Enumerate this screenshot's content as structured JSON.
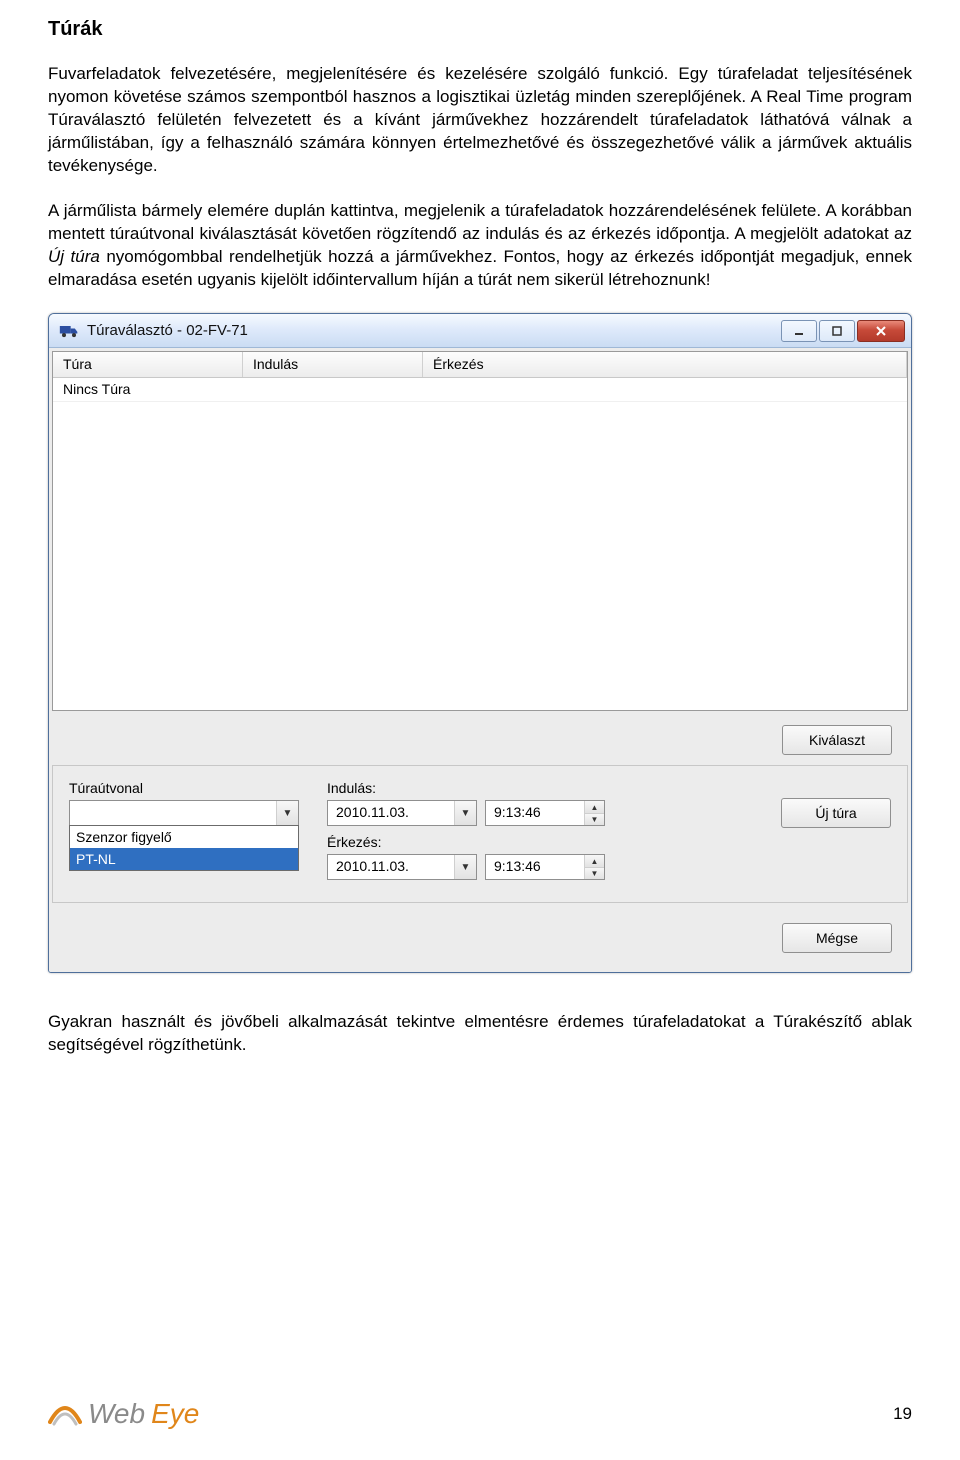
{
  "doc": {
    "heading": "Túrák",
    "p1": "Fuvarfeladatok felvezetésére, megjelenítésére és kezelésére szolgáló funkció. Egy túrafeladat teljesítésének nyomon követése számos szempontból hasznos a logisztikai üzletág minden szereplőjének. A Real Time program Túraválasztó felületén felvezetett és a kívánt járművekhez hozzárendelt túrafeladatok láthatóvá válnak a járműlistában, így a felhasználó számára könnyen értelmezhetővé és összegezhetővé válik a járművek aktuális tevékenysége.",
    "p2_a": "A járműlista bármely elemére duplán kattintva, megjelenik a túrafeladatok hozzárendelésének felülete. A korábban mentett túraútvonal kiválasztását követően rögzítendő az indulás és az érkezés időpontja. A megjelölt adatokat az ",
    "p2_b": "Új túra",
    "p2_c": " nyomógombbal rendelhetjük hozzá a járművekhez. Fontos, hogy az érkezés időpontját megadjuk, ennek elmaradása esetén ugyanis kijelölt időintervallum híján a túrát nem sikerül létrehoznunk!",
    "p3": "Gyakran használt és jövőbeli alkalmazását tekintve elmentésre érdemes túrafeladatokat a Túrakészítő ablak segítségével rögzíthetünk.",
    "page_number": "19",
    "logo_web": "Web",
    "logo_eye": "Eye"
  },
  "win": {
    "title": "Túraválasztó - 02-FV-71",
    "columns": {
      "c1": "Túra",
      "c2": "Indulás",
      "c3": "Érkezés"
    },
    "row1": "Nincs Túra",
    "btn_select": "Kiválaszt",
    "btn_newtour": "Új túra",
    "btn_cancel": "Mégse",
    "form": {
      "route_label": "Túraútvonal",
      "route_value": "",
      "options": {
        "o1": "Szenzor figyelő",
        "o2": "PT-NL"
      },
      "depart_label": "Indulás:",
      "arrive_label": "Érkezés:",
      "date1": "2010.11.03.",
      "time1": "9:13:46",
      "date2": "2010.11.03.",
      "time2": "9:13:46"
    }
  }
}
